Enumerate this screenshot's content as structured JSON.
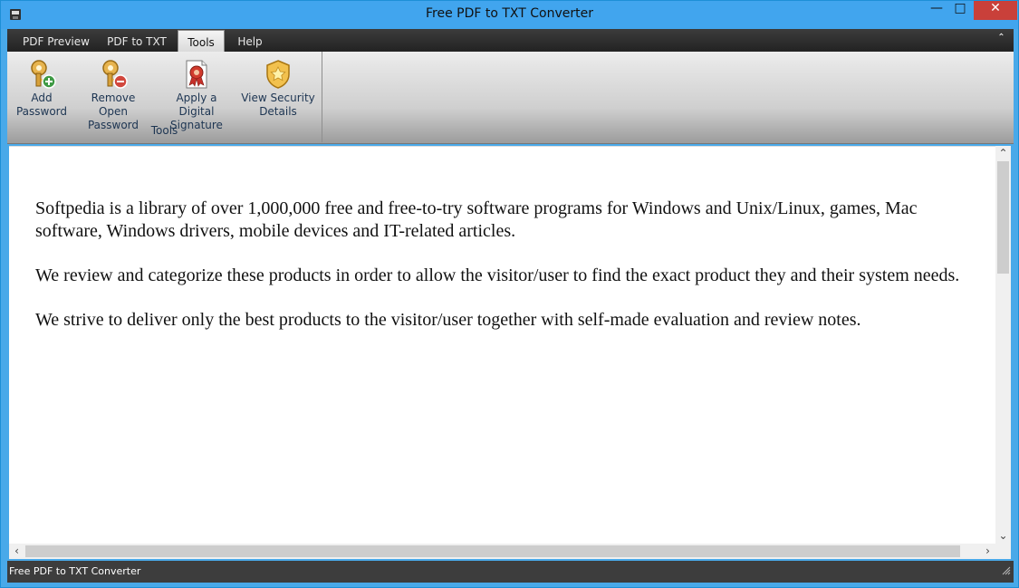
{
  "window": {
    "title": "Free PDF to TXT Converter",
    "controls": {
      "minimize": "—",
      "maximize": "□",
      "close": "✕"
    }
  },
  "tabs": [
    {
      "label": "PDF Preview"
    },
    {
      "label": "PDF to TXT"
    },
    {
      "label": "Tools",
      "active": true
    },
    {
      "label": "Help"
    }
  ],
  "ribbon": {
    "group_label": "Tools",
    "buttons": [
      {
        "label_line1": "Add",
        "label_line2": "Password",
        "icon": "key-add-icon"
      },
      {
        "label_line1": "Remove Open",
        "label_line2": "Password",
        "icon": "key-remove-icon"
      },
      {
        "label_line1": "Apply a Digital",
        "label_line2": "Signature",
        "icon": "certificate-icon"
      },
      {
        "label_line1": "View Security",
        "label_line2": "Details",
        "icon": "security-badge-icon"
      }
    ]
  },
  "document": {
    "paragraphs": [
      "Softpedia is a library of over 1,000,000 free and free-to-try software programs for Windows and Unix/Linux, games, Mac software, Windows drivers, mobile devices and IT-related articles.",
      "We review and categorize these products in order to allow the visitor/user to find the exact product they and their system needs.",
      "We strive to deliver only the best products to the visitor/user together with self-made evaluation and review notes."
    ]
  },
  "status": {
    "text": "Free PDF to TXT Converter"
  },
  "colors": {
    "titlebar": "#41a5ee",
    "close_button": "#c9403a",
    "tab_strip": "#2e2e2e",
    "status_bar": "#3d3d3d"
  }
}
